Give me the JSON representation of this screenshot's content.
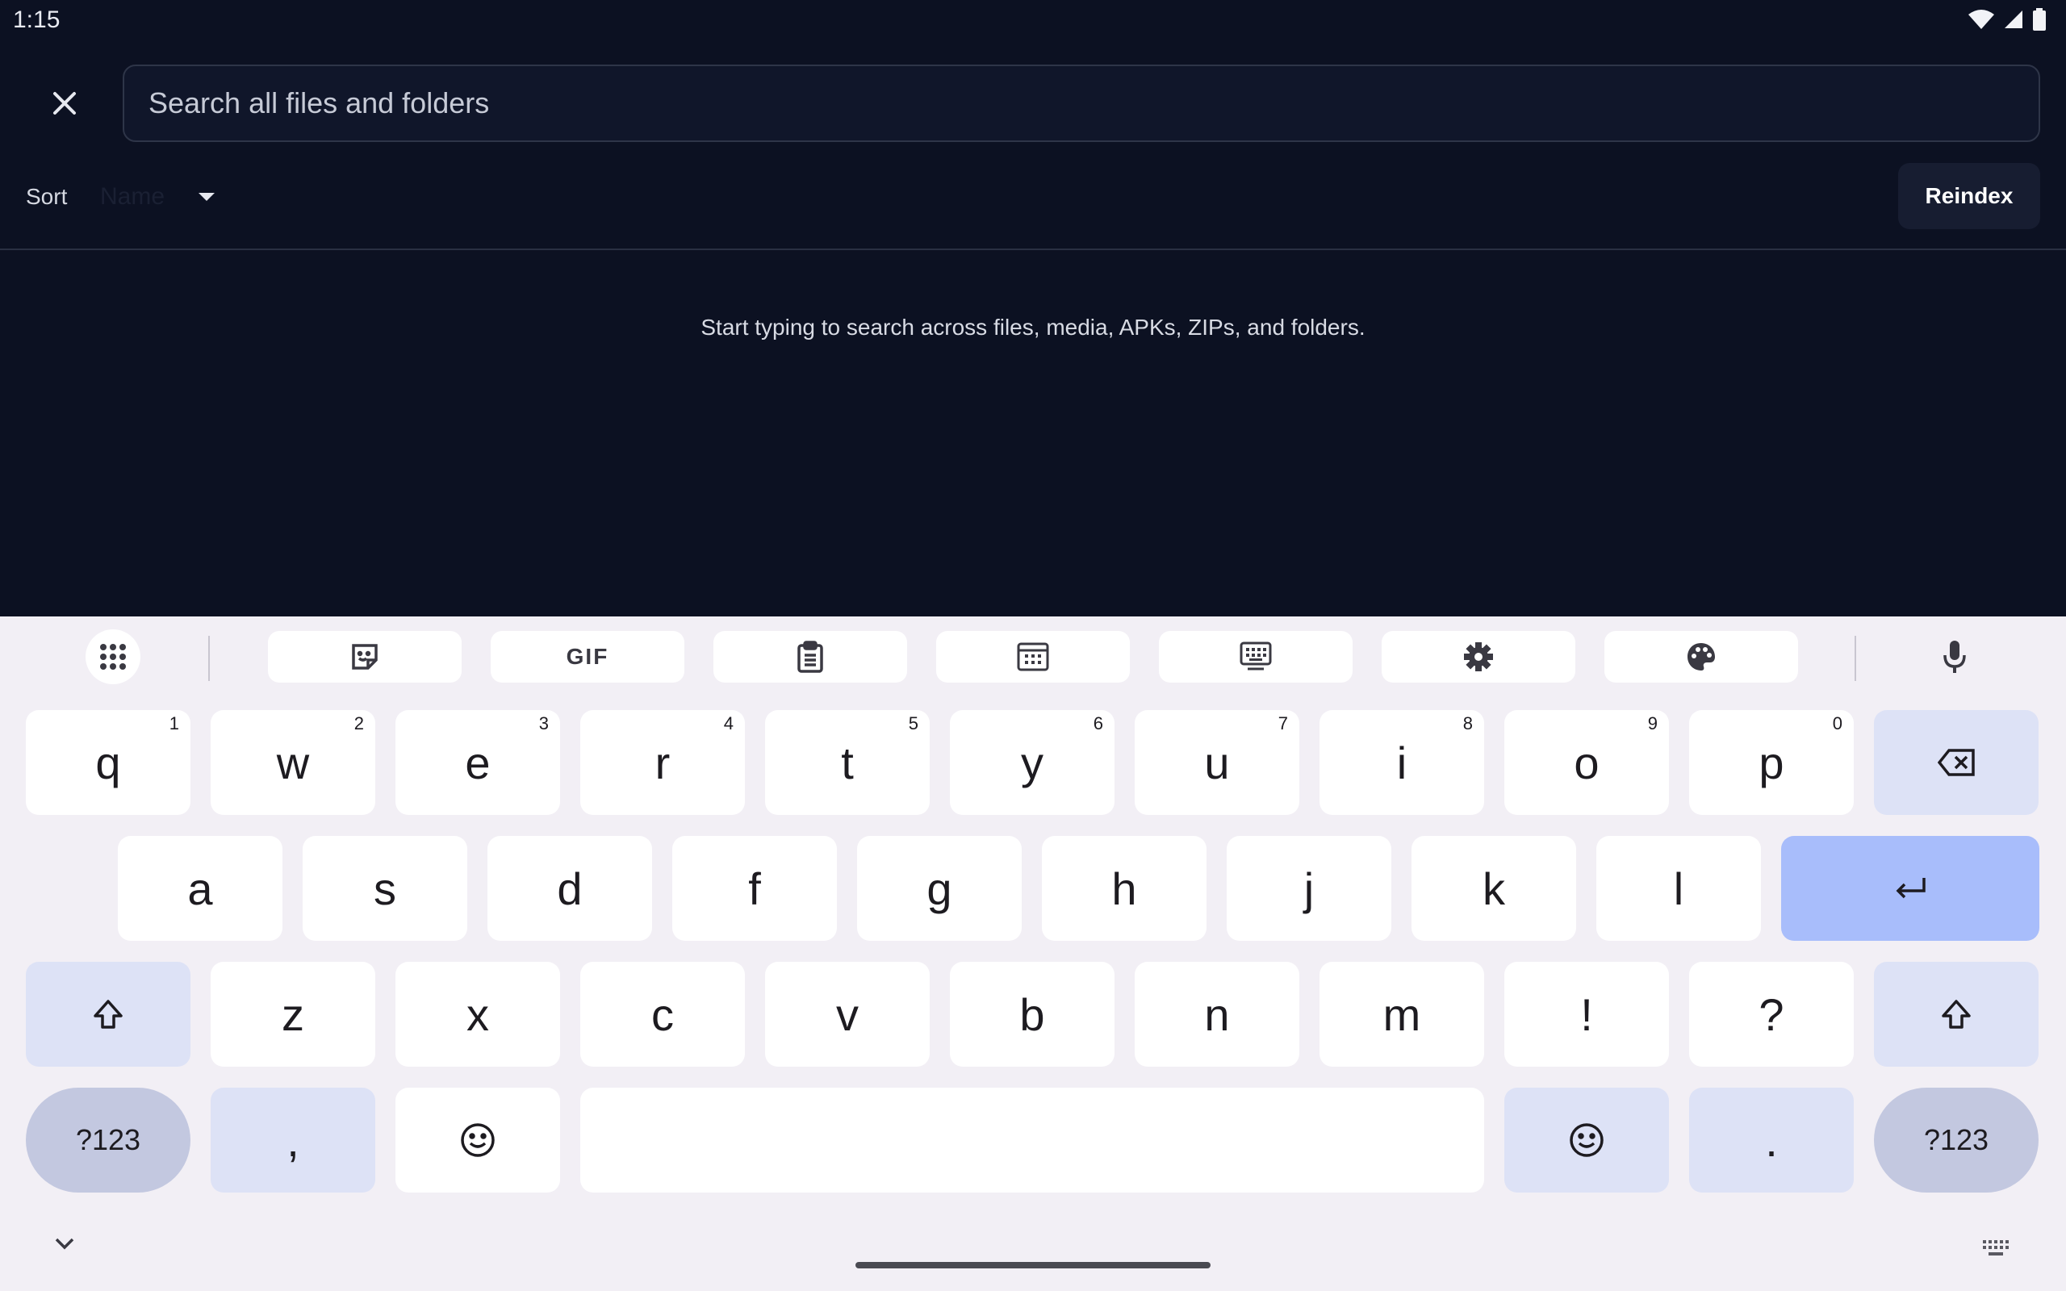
{
  "status": {
    "time": "1:15"
  },
  "search": {
    "placeholder": "Search all files and folders",
    "value": ""
  },
  "sort": {
    "label": "Sort",
    "value": "Name"
  },
  "actions": {
    "reindex_label": "Reindex"
  },
  "hint": "Start typing to search across files, media, APKs, ZIPs, and folders.",
  "keyboard": {
    "toolbar": [
      "sticker-icon",
      "gif-icon",
      "clipboard-icon",
      "number-pad-icon",
      "floating-keyboard-icon",
      "settings-icon",
      "palette-icon"
    ],
    "gif_label": "GIF",
    "row1": [
      {
        "key": "q",
        "hint": "1"
      },
      {
        "key": "w",
        "hint": "2"
      },
      {
        "key": "e",
        "hint": "3"
      },
      {
        "key": "r",
        "hint": "4"
      },
      {
        "key": "t",
        "hint": "5"
      },
      {
        "key": "y",
        "hint": "6"
      },
      {
        "key": "u",
        "hint": "7"
      },
      {
        "key": "i",
        "hint": "8"
      },
      {
        "key": "o",
        "hint": "9"
      },
      {
        "key": "p",
        "hint": "0"
      }
    ],
    "row2": [
      "a",
      "s",
      "d",
      "f",
      "g",
      "h",
      "j",
      "k",
      "l"
    ],
    "row3": [
      "z",
      "x",
      "c",
      "v",
      "b",
      "n",
      "m",
      "!",
      "?"
    ],
    "symbols_label": "?123",
    "comma": ",",
    "period": "."
  }
}
